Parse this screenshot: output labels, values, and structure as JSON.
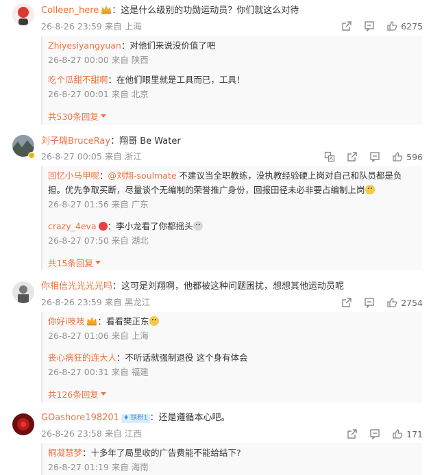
{
  "comments": [
    {
      "user": "Colleen_here",
      "text": "：这是什么级别的功勋运动员？你们就这么对待",
      "time": "26-8-26 23:59 来自 上海",
      "likes": "6275",
      "replies": [
        {
          "user": "Zhiyesiyangyuan",
          "text": "：对他们来说没价值了吧",
          "meta": "26-8-27 00:00 来自 陕西"
        },
        {
          "user": "吃个瓜甜不甜啊",
          "text": "：在他们眼里就是工具而已，工具！",
          "meta": "26-8-27 00:01 来自 北京"
        }
      ],
      "more": "共530条回复"
    },
    {
      "user": "刘子瑞BruceRay",
      "text": "：翔哥 Be Water",
      "time": "26-8-27 00:05 来自 浙江",
      "likes": "596",
      "replies": [
        {
          "user": "回忆小马甲呢",
          "mention": "@刘翔-soulmate",
          "text_line1": " 不建议当全职教练，没执教经验硬上岗对自己和队员都是负",
          "text_line2": "担。优先争取买断，尽量谈个无编制的荣誉推广身份，回报田径未必非要占编制上岗",
          "meta": "26-8-27 01:56 来自 广东"
        },
        {
          "user": "crazy_4eva",
          "text": "：李小龙看了你都摇头",
          "meta": "26-8-27 07:50 来自 湖北"
        }
      ],
      "more": "共15条回复"
    },
    {
      "user": "你相信光光光光吗",
      "text": "：这可是刘翔啊，他都被这种问题困扰，想想其他运动员呢",
      "time": "26-8-26 23:59 来自 黑龙江",
      "likes": "2754",
      "replies": [
        {
          "user": "你好i吱吱",
          "text": "：看看樊正东",
          "meta": "26-8-27 01:06 来自 上海"
        },
        {
          "user": "丧心病狂的连大人",
          "text": "：不听话就强制退役 这个身有体会",
          "meta": "26-8-27 00:31 来自 福建"
        }
      ],
      "more": "共126条回复"
    },
    {
      "user": "GOashore198201",
      "badge": "铁粉1",
      "text": "：还是遵循本心吧。",
      "time": "26-8-26 23:58 来自 江西",
      "likes": "171",
      "replies": [
        {
          "user": "桐凝慧梦",
          "text": "：十多年了局里收的广告费能不能给结下?",
          "meta": "26-8-27 01:19 来自 海南"
        }
      ]
    }
  ],
  "colors": {
    "accent": "#eb7340",
    "meta": "#939393",
    "reply_bg": "#f9f9f9"
  },
  "icons": [
    "share-icon",
    "comment-icon",
    "like-icon",
    "translate-icon",
    "crown-icon"
  ]
}
